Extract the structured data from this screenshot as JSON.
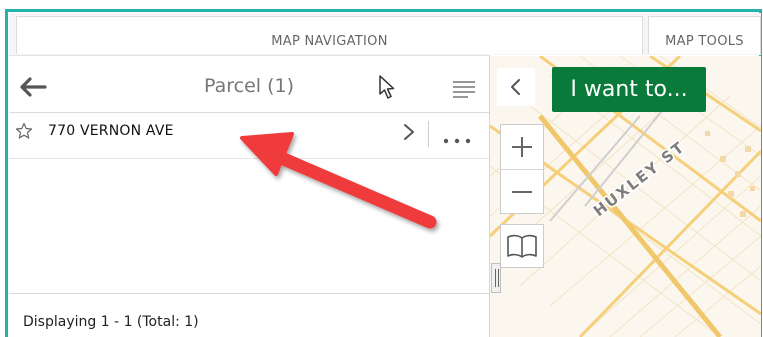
{
  "tabs": {
    "map_navigation": "MAP NAVIGATION",
    "map_tools": "MAP TOOLS"
  },
  "panel": {
    "title": "Parcel (1)",
    "results": [
      {
        "label": "770 VERNON AVE"
      }
    ],
    "footer": "Displaying 1 - 1 (Total: 1)"
  },
  "map": {
    "i_want_to_label": "I want to...",
    "street_label": "HUXLEY ST"
  },
  "colors": {
    "frame_border": "#22b3ad",
    "i_want_to_bg": "#0a7a3a",
    "annotation_arrow": "#ef3b3b",
    "map_road": "#f5cf7a"
  },
  "icons": {
    "back": "arrow-left-icon",
    "cursor": "mouse-pointer-icon",
    "menu": "list-icon",
    "favorite": "star-outline-icon",
    "open": "chevron-right-icon",
    "more": "ellipsis-icon",
    "collapse": "chevron-left-icon",
    "zoom_in": "plus-icon",
    "zoom_out": "minus-icon",
    "bookmarks": "book-open-icon"
  }
}
